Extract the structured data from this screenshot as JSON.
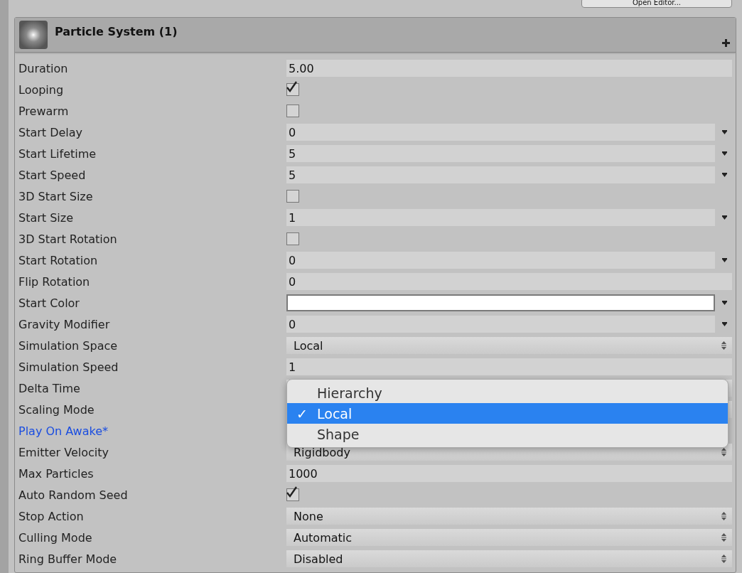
{
  "top_button": "Open Editor...",
  "component": {
    "title": "Particle System (1)"
  },
  "properties": [
    {
      "label": "Duration",
      "kind": "text",
      "value": "5.00",
      "modified": false
    },
    {
      "label": "Looping",
      "kind": "checkbox",
      "checked": true,
      "modified": false
    },
    {
      "label": "Prewarm",
      "kind": "checkbox",
      "checked": false,
      "modified": false
    },
    {
      "label": "Start Delay",
      "kind": "curve",
      "value": "0",
      "modified": false
    },
    {
      "label": "Start Lifetime",
      "kind": "curve",
      "value": "5",
      "modified": false
    },
    {
      "label": "Start Speed",
      "kind": "curve",
      "value": "5",
      "modified": false
    },
    {
      "label": "3D Start Size",
      "kind": "checkbox",
      "checked": false,
      "modified": false
    },
    {
      "label": "Start Size",
      "kind": "curve",
      "value": "1",
      "modified": false
    },
    {
      "label": "3D Start Rotation",
      "kind": "checkbox",
      "checked": false,
      "modified": false
    },
    {
      "label": "Start Rotation",
      "kind": "curve",
      "value": "0",
      "modified": false
    },
    {
      "label": "Flip Rotation",
      "kind": "text",
      "value": "0",
      "modified": false
    },
    {
      "label": "Start Color",
      "kind": "color",
      "color": "#ffffff",
      "modified": false
    },
    {
      "label": "Gravity Modifier",
      "kind": "curve",
      "value": "0",
      "modified": false
    },
    {
      "label": "Simulation Space",
      "kind": "popup",
      "value": "Local",
      "modified": false
    },
    {
      "label": "Simulation Speed",
      "kind": "text",
      "value": "1",
      "modified": false
    },
    {
      "label": "Delta Time",
      "kind": "popup",
      "modified": false
    },
    {
      "label": "Scaling Mode",
      "kind": "popup",
      "modified": false
    },
    {
      "label": "Play On Awake*",
      "kind": "none",
      "modified": true
    },
    {
      "label": "Emitter Velocity",
      "kind": "popup",
      "value": "Rigidbody",
      "modified": false
    },
    {
      "label": "Max Particles",
      "kind": "text",
      "value": "1000",
      "modified": false
    },
    {
      "label": "Auto Random Seed",
      "kind": "checkbox",
      "checked": true,
      "modified": false
    },
    {
      "label": "Stop Action",
      "kind": "popup",
      "value": "None",
      "modified": false
    },
    {
      "label": "Culling Mode",
      "kind": "popup",
      "value": "Automatic",
      "modified": false
    },
    {
      "label": "Ring Buffer Mode",
      "kind": "popup",
      "value": "Disabled",
      "modified": false
    }
  ],
  "menu": {
    "check": "✓",
    "options": [
      {
        "label": "Hierarchy",
        "selected": false
      },
      {
        "label": "Local",
        "selected": true
      },
      {
        "label": "Shape",
        "selected": false
      }
    ]
  }
}
